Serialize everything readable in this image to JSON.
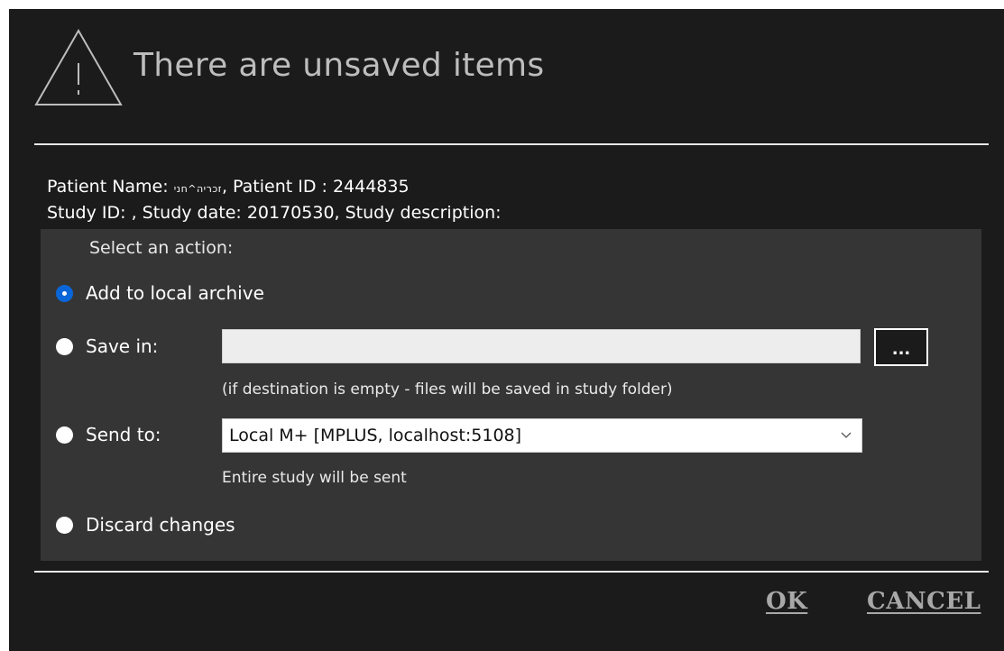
{
  "dialog": {
    "title": "There are unsaved items",
    "icon": "warning-triangle-icon"
  },
  "info": {
    "line1_prefix": "Patient Name: ",
    "patient_name": "זכריה^חני",
    "line1_suffix": ", Patient ID : 2444835",
    "line2": "Study ID: , Study date: 20170530, Study description:"
  },
  "actions": {
    "heading": "Select an action:",
    "options": [
      {
        "label": "Add to local archive",
        "selected": true
      },
      {
        "label": "Save in:",
        "selected": false
      },
      {
        "label": "Send to:",
        "selected": false
      },
      {
        "label": "Discard changes",
        "selected": false
      }
    ],
    "save_path_value": "",
    "browse_label": "...",
    "save_hint": "(if destination is empty - files will be saved in study folder)",
    "send_to_selected": "Local M+ [MPLUS, localhost:5108]",
    "send_hint": "Entire study will be sent"
  },
  "buttons": {
    "ok": "OK",
    "cancel": "CANCEL"
  },
  "colors": {
    "background": "#1b1b1b",
    "panel": "#353535",
    "radio_selected": "#0a66d8",
    "button_text": "#a8a8a8"
  }
}
